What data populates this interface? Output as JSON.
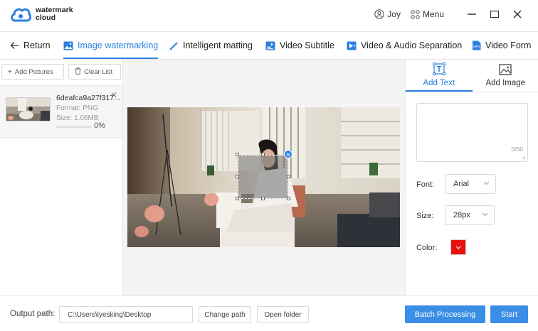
{
  "app": {
    "name_line1": "watermark",
    "name_line2": "cloud"
  },
  "titlebar": {
    "user": "Joy",
    "menu": "Menu"
  },
  "tabs": [
    {
      "label": "Return",
      "icon": "arrow-left-icon"
    },
    {
      "label": "Image watermarking",
      "icon": "image-icon",
      "active": true
    },
    {
      "label": "Intelligent matting",
      "icon": "magic-wand-icon"
    },
    {
      "label": "Video Subtitle",
      "icon": "video-subtitle-icon"
    },
    {
      "label": "Video & Audio Separation",
      "icon": "video-audio-icon"
    },
    {
      "label": "Video Form",
      "icon": "video-format-icon"
    }
  ],
  "left": {
    "add_pictures": "Add Pictures",
    "clear_list": "Clear List",
    "file": {
      "name": "6deafca9a27f317...",
      "format": "Format:  PNG",
      "size": "Size:  1.06MB",
      "progress": "0%"
    }
  },
  "right": {
    "tabs": [
      {
        "label": "Add Text",
        "active": true
      },
      {
        "label": "Add Image"
      }
    ],
    "text_counter": "0/50",
    "font_label": "Font:",
    "font_value": "Arial",
    "size_label": "Size:",
    "size_value": "28px",
    "color_label": "Color:",
    "color_value": "#e8110e"
  },
  "footer": {
    "output_label": "Output path:",
    "output_path": "C:\\Users\\lyesking\\Desktop",
    "change_path": "Change path",
    "open_folder": "Open folder",
    "batch": "Batch Processing",
    "start": "Start"
  },
  "colors": {
    "accent": "#2b7fe0",
    "button_blue": "#3a8ee6"
  }
}
